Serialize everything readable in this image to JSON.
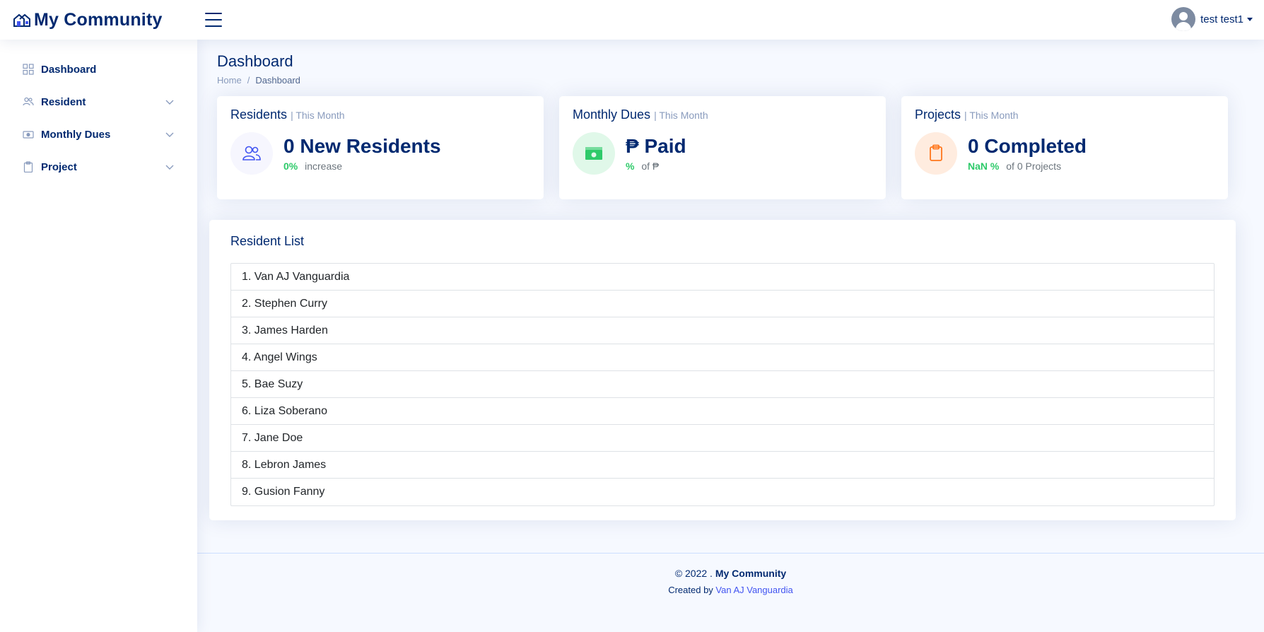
{
  "header": {
    "brand": "My Community",
    "user_name": "test test1"
  },
  "sidebar": {
    "items": [
      {
        "label": "Dashboard",
        "icon": "grid-icon"
      },
      {
        "label": "Resident",
        "icon": "people-icon"
      },
      {
        "label": "Monthly Dues",
        "icon": "cash-icon"
      },
      {
        "label": "Project",
        "icon": "clipboard-icon"
      }
    ]
  },
  "page": {
    "title": "Dashboard",
    "breadcrumb": {
      "home": "Home",
      "sep": "/",
      "current": "Dashboard"
    }
  },
  "cards": {
    "residents": {
      "title": "Residents",
      "period": "| This Month",
      "value": "0 New Residents",
      "pct": "0%",
      "desc": "increase",
      "color": "#4154f1",
      "bg": "#f6f6fe"
    },
    "dues": {
      "title": "Monthly Dues",
      "period": "| This Month",
      "value": "₱ Paid",
      "pct": "%",
      "desc": "of ₱",
      "color": "#2eca6a",
      "bg": "#e0f8e9"
    },
    "projects": {
      "title": "Projects",
      "period": "| This Month",
      "value": "0 Completed",
      "pct": "NaN %",
      "desc": "of 0 Projects",
      "color": "#ff771d",
      "bg": "#ffecdf"
    }
  },
  "resident_list": {
    "title": "Resident List",
    "items": [
      "1. Van AJ Vanguardia",
      "2. Stephen Curry",
      "3. James Harden",
      "4. Angel Wings",
      "5. Bae Suzy",
      "6. Liza Soberano",
      "7. Jane Doe",
      "8. Lebron James",
      "9. Gusion Fanny"
    ]
  },
  "footer": {
    "copyright": "© 2022 . ",
    "brand": "My Community",
    "created_by": "Created by ",
    "author": "Van AJ Vanguardia"
  }
}
